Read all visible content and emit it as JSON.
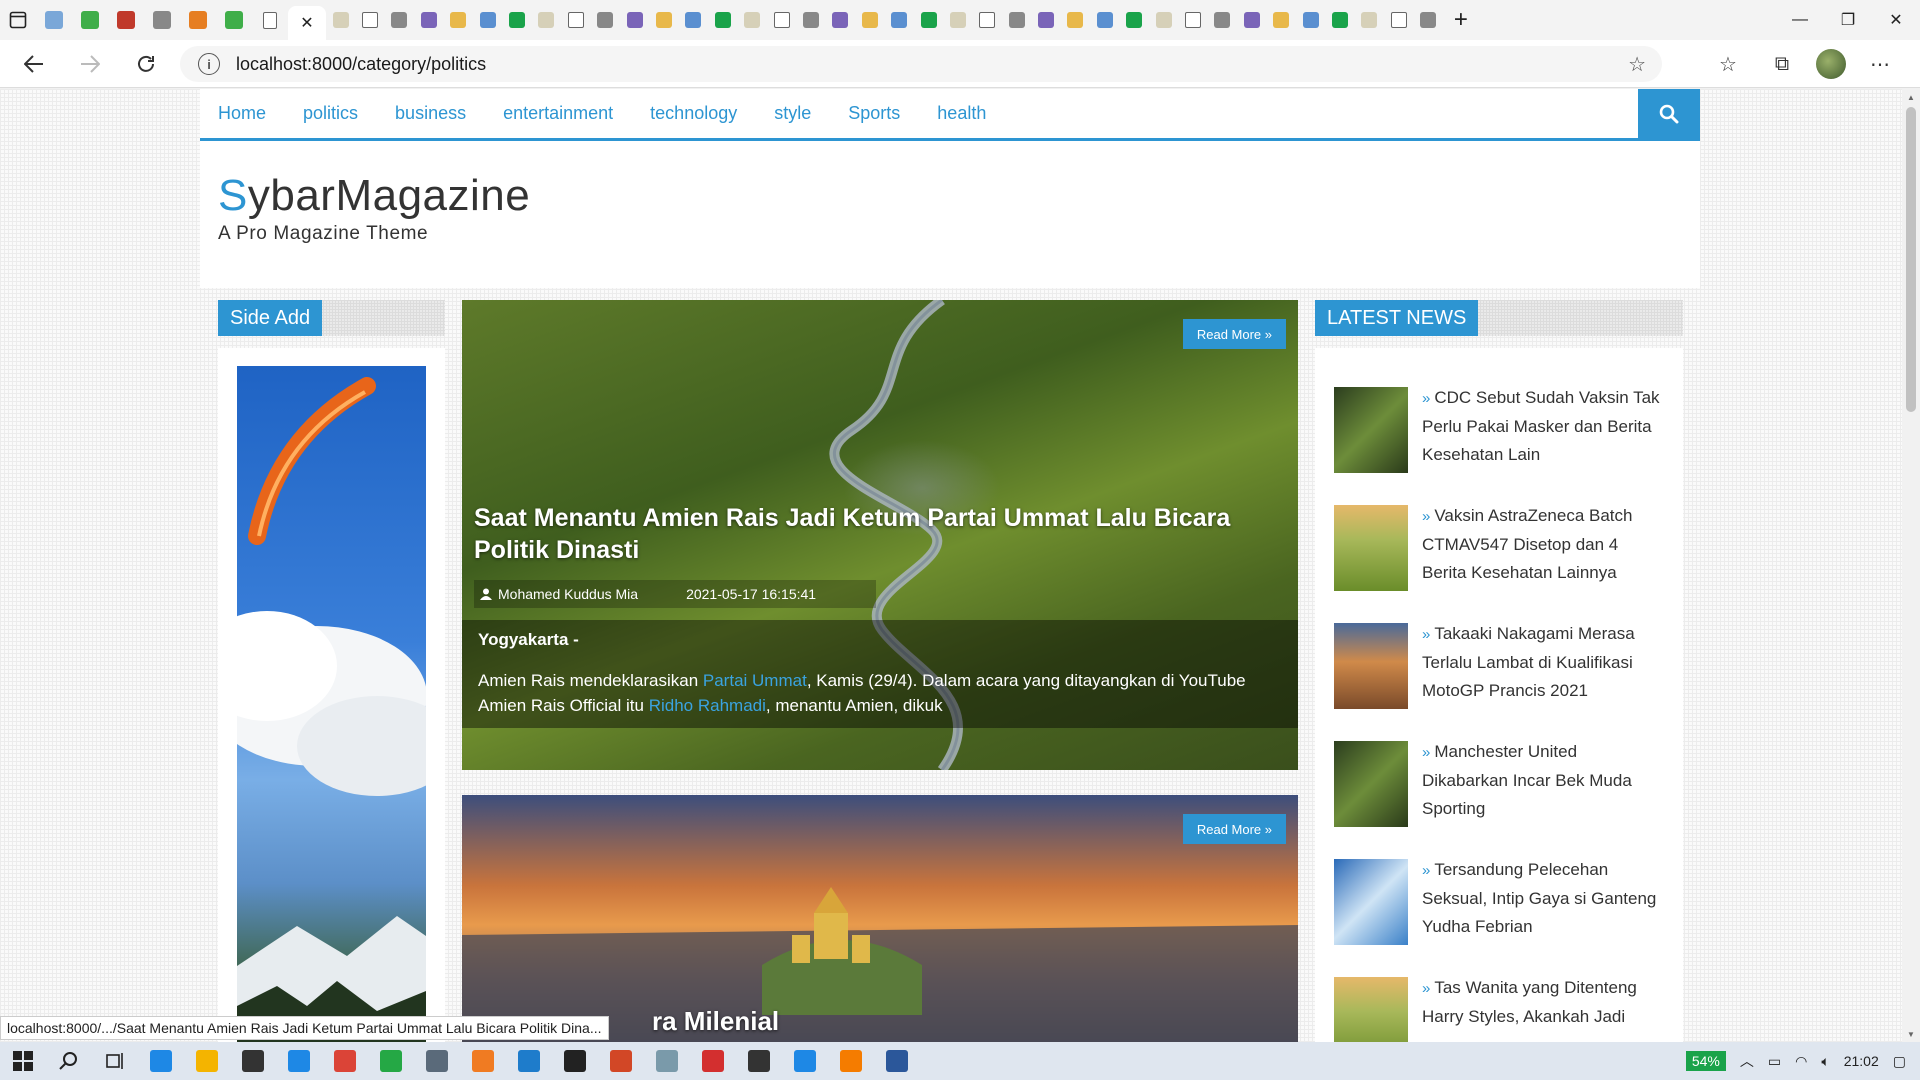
{
  "browser": {
    "active_tab_close": "✕",
    "new_tab": "+",
    "url": "localhost:8000/category/politics",
    "tab_favicons": [
      {
        "icon": "edge-icon",
        "color": "#7aa7d8"
      },
      {
        "icon": "green-plus-icon",
        "color": "#3fae49"
      },
      {
        "icon": "mail-icon",
        "color": "#c0392b"
      },
      {
        "icon": "puzzle-icon",
        "color": "#888888"
      },
      {
        "icon": "pma-icon",
        "color": "#e67e22"
      },
      {
        "icon": "green-plus-icon",
        "color": "#3fae49"
      },
      {
        "icon": "doc-icon",
        "color": "#ffffff"
      }
    ],
    "more_favicons_count": 38,
    "window_controls": [
      "—",
      "❐",
      "✕"
    ]
  },
  "nav": {
    "items": [
      {
        "label": "Home"
      },
      {
        "label": "politics"
      },
      {
        "label": "business"
      },
      {
        "label": "entertainment"
      },
      {
        "label": "technology"
      },
      {
        "label": "style"
      },
      {
        "label": "Sports"
      },
      {
        "label": "health"
      }
    ]
  },
  "header": {
    "logo_first": "S",
    "logo_rest": "ybarMagazine",
    "tagline": "A Pro Magazine Theme"
  },
  "sidebar": {
    "title": "Side Add"
  },
  "posts": [
    {
      "read_more": "Read More »",
      "title": "Saat Menantu Amien Rais Jadi Ketum Partai Ummat Lalu Bicara Politik Dinasti",
      "author": "Mohamed Kuddus Mia",
      "date": "2021-05-17 16:15:41",
      "city": "Yogyakarta -",
      "excerpt_1": "Amien Rais mendeklarasikan ",
      "link_1": "Partai Ummat",
      "excerpt_2": ", Kamis (29/4). Dalam acara yang ditayangkan di YouTube Amien Rais Official itu ",
      "link_2": "Ridho Rahmadi",
      "excerpt_3": ", menantu Amien, dikuk"
    },
    {
      "read_more": "Read More »",
      "title_visible": "ra Milenial"
    }
  ],
  "latest": {
    "title": "LATEST NEWS",
    "items": [
      {
        "text": "CDC Sebut Sudah Vaksin Tak Perlu Pakai Masker dan Berita Kesehatan Lain",
        "thumb": "#3f5a2d"
      },
      {
        "text": "Vaksin AstraZeneca Batch CTMAV547 Disetop dan 4 Berita Kesehatan Lainnya",
        "thumb": "#8aa53a"
      },
      {
        "text": "Takaaki Nakagami Merasa Terlalu Lambat di Kualifikasi MotoGP Prancis 2021",
        "thumb": "#c06a3a"
      },
      {
        "text": "Manchester United Dikabarkan Incar Bek Muda Sporting",
        "thumb": "#3f5a2d"
      },
      {
        "text": "Tersandung Pelecehan Seksual, Intip Gaya si Ganteng Yudha Febrian",
        "thumb": "#4a8fd0"
      },
      {
        "text": "Tas Wanita yang Ditenteng Harry Styles, Akankah Jadi",
        "thumb": "#8aa53a"
      }
    ]
  },
  "status_bar": {
    "hover_url": "localhost:8000/.../Saat Menantu Amien Rais Jadi Ketum Partai Ummat Lalu Bicara Politik Dina..."
  },
  "taskbar": {
    "battery": "54%",
    "time": "21:02",
    "apps": [
      {
        "icon": "edge-icon",
        "color": "#1e88e5"
      },
      {
        "icon": "folder-icon",
        "color": "#f4b400"
      },
      {
        "icon": "mail-icon",
        "color": "#333333"
      },
      {
        "icon": "l-app-icon",
        "color": "#1e88e5"
      },
      {
        "icon": "chrome-icon",
        "color": "#db4437"
      },
      {
        "icon": "whatsapp-icon",
        "color": "#25a845"
      },
      {
        "icon": "photos-icon",
        "color": "#5a6a7a"
      },
      {
        "icon": "sublime-icon",
        "color": "#f07b22"
      },
      {
        "icon": "vscode-icon",
        "color": "#1e7ccb"
      },
      {
        "icon": "terminal-icon",
        "color": "#222222"
      },
      {
        "icon": "powerpoint-icon",
        "color": "#d24726"
      },
      {
        "icon": "app-icon",
        "color": "#7a9aaa"
      },
      {
        "icon": "pdf-icon",
        "color": "#d32f2f"
      },
      {
        "icon": "gallery-icon",
        "color": "#333333"
      },
      {
        "icon": "infinity-icon",
        "color": "#1e88e5"
      },
      {
        "icon": "xampp-icon",
        "color": "#f57c00"
      },
      {
        "icon": "word-icon",
        "color": "#2b579a"
      }
    ]
  }
}
